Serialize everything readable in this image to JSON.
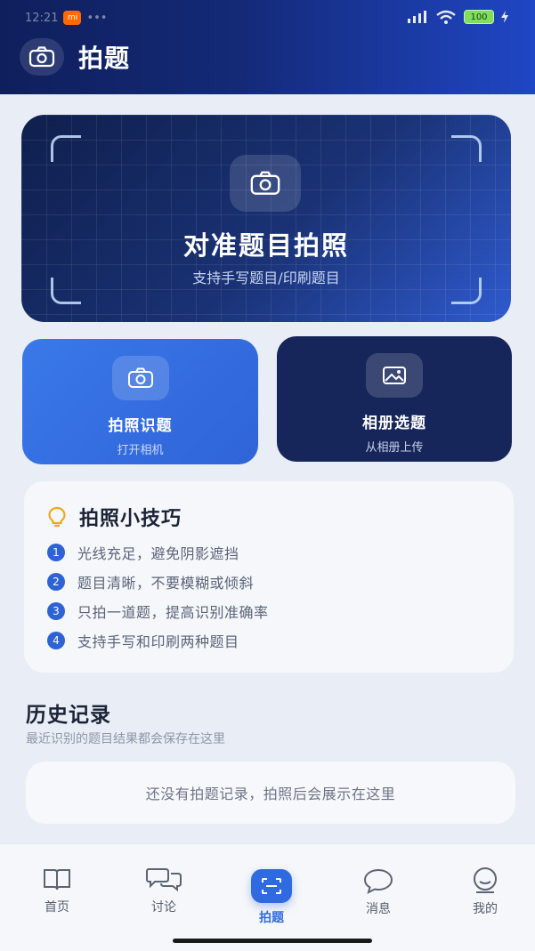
{
  "status": {
    "time": "12:21",
    "carrier_badge": "mi",
    "dots": "•••",
    "battery": "100"
  },
  "header": {
    "title": "拍题",
    "icon": "camera-icon"
  },
  "hero": {
    "title": "对准题目拍照",
    "subtitle": "支持手写题目/印刷题目",
    "icon": "camera-icon"
  },
  "actions": {
    "camera": {
      "title": "拍照识题",
      "subtitle": "打开相机",
      "icon": "camera-icon"
    },
    "album": {
      "title": "相册选题",
      "subtitle": "从相册上传",
      "icon": "image-icon"
    }
  },
  "tips": {
    "title": "拍照小技巧",
    "icon": "lightbulb-icon",
    "items": [
      {
        "num": "1",
        "text": "光线充足，避免阴影遮挡"
      },
      {
        "num": "2",
        "text": "题目清晰，不要模糊或倾斜"
      },
      {
        "num": "3",
        "text": "只拍一道题，提高识别准确率"
      },
      {
        "num": "4",
        "text": "支持手写和印刷两种题目"
      }
    ]
  },
  "history": {
    "title": "历史记录",
    "subtitle": "最近识别的题目结果都会保存在这里",
    "empty": "还没有拍题记录，拍照后会展示在这里"
  },
  "tabbar": {
    "items": [
      {
        "label": "首页",
        "icon": "book-icon"
      },
      {
        "label": "讨论",
        "icon": "chat-bubbles-icon"
      },
      {
        "label": "拍题",
        "icon": "scan-icon",
        "active": true
      },
      {
        "label": "消息",
        "icon": "message-icon"
      },
      {
        "label": "我的",
        "icon": "profile-icon"
      }
    ]
  },
  "colors": {
    "accent": "#2f6ae0",
    "header_start": "#0f1f5c",
    "header_end": "#1f46c4",
    "album_card": "#17265a"
  }
}
